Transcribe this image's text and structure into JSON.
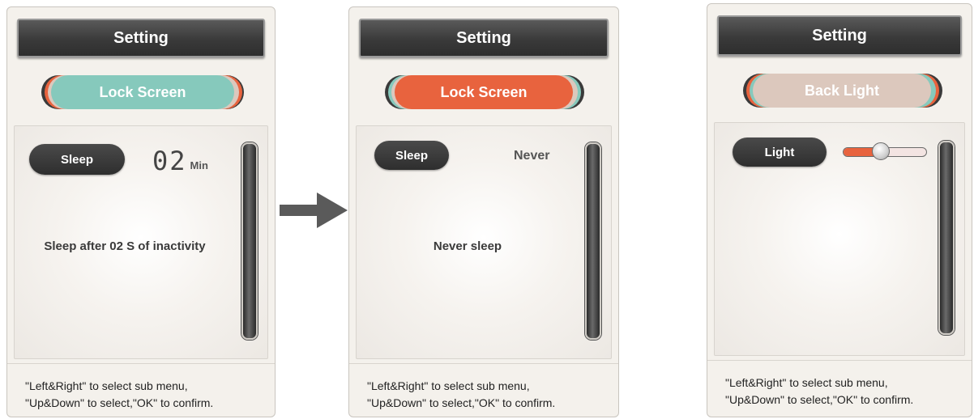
{
  "screens": [
    {
      "title": "Setting",
      "menu_item": "Lock Screen",
      "option_label": "Sleep",
      "option_value": "02",
      "option_unit": "Min",
      "message": "Sleep after 02 S of inactivity"
    },
    {
      "title": "Setting",
      "menu_item": "Lock Screen",
      "option_label": "Sleep",
      "option_value": "Never",
      "message": "Never sleep"
    },
    {
      "title": "Setting",
      "menu_item": "Back Light",
      "option_label": "Light",
      "slider_level": 0.45
    }
  ],
  "hint": {
    "line1": "\"Left&Right\" to select sub menu,",
    "line2": "\"Up&Down\" to select,\"OK\" to confirm."
  },
  "colors": {
    "teal": "#86c9bc",
    "orange": "#e8633e",
    "beige": "#dcc8bd",
    "dark": "#333333"
  },
  "transition_icon": "right-arrow-icon"
}
